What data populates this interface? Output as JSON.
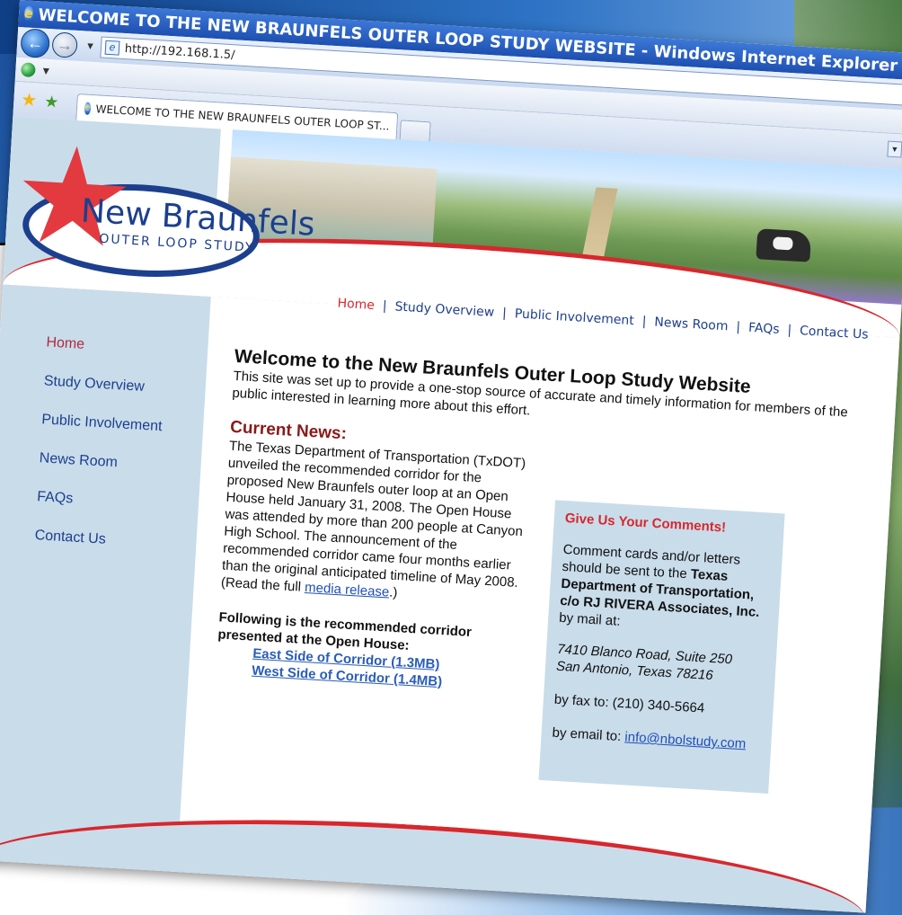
{
  "browser": {
    "window_title": "WELCOME TO THE NEW BRAUNFELS OUTER LOOP STUDY WEBSITE - Windows Internet Explorer provided by RJ RIVE",
    "url": "http://192.168.1.5/",
    "tab_title": "WELCOME TO THE NEW BRAUNFELS OUTER LOOP ST..."
  },
  "logo": {
    "title": "New Braunfels",
    "subtitle": "OUTER LOOP STUDY"
  },
  "topnav": {
    "items": [
      "Home",
      "Study Overview",
      "Public Involvement",
      "News Room",
      "FAQs",
      "Contact Us"
    ]
  },
  "sidenav": {
    "items": [
      "Home",
      "Study Overview",
      "Public Involvement",
      "News Room",
      "FAQs",
      "Contact Us"
    ]
  },
  "welcome": {
    "title": "Welcome to the New Braunfels Outer Loop Study Website",
    "text_before": "This site was set up to provide a one-stop source of accurate and timely information for members of the public interested in learning more about this effort."
  },
  "news": {
    "title": "Current News:",
    "body": "The Texas Department of Transportation (TxDOT) unveiled the recommended corridor for the proposed New Braunfels outer loop at an Open House held January 31, 2008. The Open House was attended by more than 200 people at Canyon High School. The announcement of the recommended corridor came four months earlier than the original anticipated timeline of May 2008. (Read the full ",
    "link": "media release",
    "after_link": ".)",
    "following": "Following is the recommended corridor presented at the Open House:",
    "east_link": "East Side of Corridor (1.3MB)",
    "west_link": "West Side of Corridor (1.4MB)"
  },
  "comments": {
    "title": "Give Us Your Comments!",
    "intro": "Comment cards and/or letters should be sent to the ",
    "bold": "Texas Department of Transportation, c/o RJ RIVERA Associates, Inc.",
    "by_mail": "by mail at:",
    "addr1": "7410 Blanco Road, Suite 250",
    "addr2": "San Antonio, Texas 78216",
    "fax": "by fax to: (210) 340-5664",
    "email_label": "by email to: ",
    "email": "info@nbolstudy.com"
  }
}
